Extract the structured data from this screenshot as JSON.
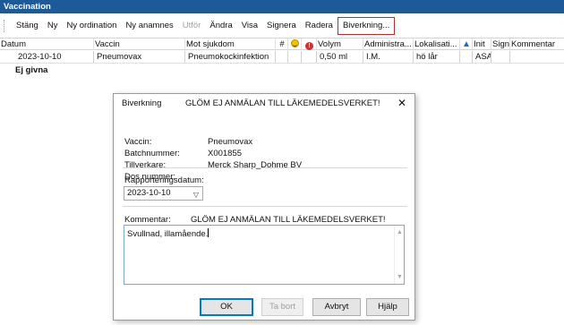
{
  "window": {
    "title": "Vaccination"
  },
  "toolbar": {
    "buttons": [
      {
        "label": "Stäng"
      },
      {
        "label": "Ny"
      },
      {
        "label": "Ny ordination"
      },
      {
        "label": "Ny anamnes"
      },
      {
        "label": "Utför"
      },
      {
        "label": "Ändra"
      },
      {
        "label": "Visa"
      },
      {
        "label": "Signera"
      },
      {
        "label": "Radera"
      },
      {
        "label": "Biverkning..."
      }
    ]
  },
  "grid": {
    "headers": {
      "datum": "Datum",
      "vaccin": "Vaccin",
      "mot_sjukdom": "Mot sjukdom",
      "nr": "#",
      "volym": "Volym",
      "administration": "Administra...",
      "lokalisation": "Lokalisati...",
      "init": "Init",
      "sign": "Sign",
      "kommentar": "Kommentar"
    },
    "header_icons": [
      "smile-icon",
      "alert-icon",
      "arrow-up-icon"
    ],
    "row": {
      "datum": "2023-10-10",
      "vaccin": "Pneumovax",
      "mot_sjukdom": "Pneumokockinfektion",
      "volym": "0,50 ml",
      "administration": "I.M.",
      "lokalisation": "hö lår",
      "init": "ASA"
    },
    "group_label": "Ej givna"
  },
  "dialog": {
    "title": "Biverkning",
    "title_message": "GLÖM EJ ANMÄLAN TILL LÄKEMEDELSVERKET!",
    "fields": {
      "vaccin_label": "Vaccin:",
      "vaccin_value": "Pneumovax",
      "batch_label": "Batchnummer:",
      "batch_value": "X001855",
      "tillverkare_label": "Tillverkare:",
      "tillverkare_value": "Merck Sharp_Dohme BV",
      "dos_label": "Dos nummer:",
      "dos_value": ""
    },
    "rapport_label": "Rapporteringsdatum:",
    "rapport_value": "2023-10-10",
    "kommentar_label": "Kommentar:",
    "kommentar_message": "GLÖM EJ ANMÄLAN TILL LÄKEMEDELSVERKET!",
    "kommentar_value": "Svullnad, illamående.",
    "buttons": {
      "ok": "OK",
      "ta_bort": "Ta bort",
      "avbryt": "Avbryt",
      "hjalp": "Hjälp"
    }
  },
  "colors": {
    "titlebar": "#1e5a99",
    "highlight_border": "#c62828",
    "focus_border": "#7aa7d8"
  }
}
